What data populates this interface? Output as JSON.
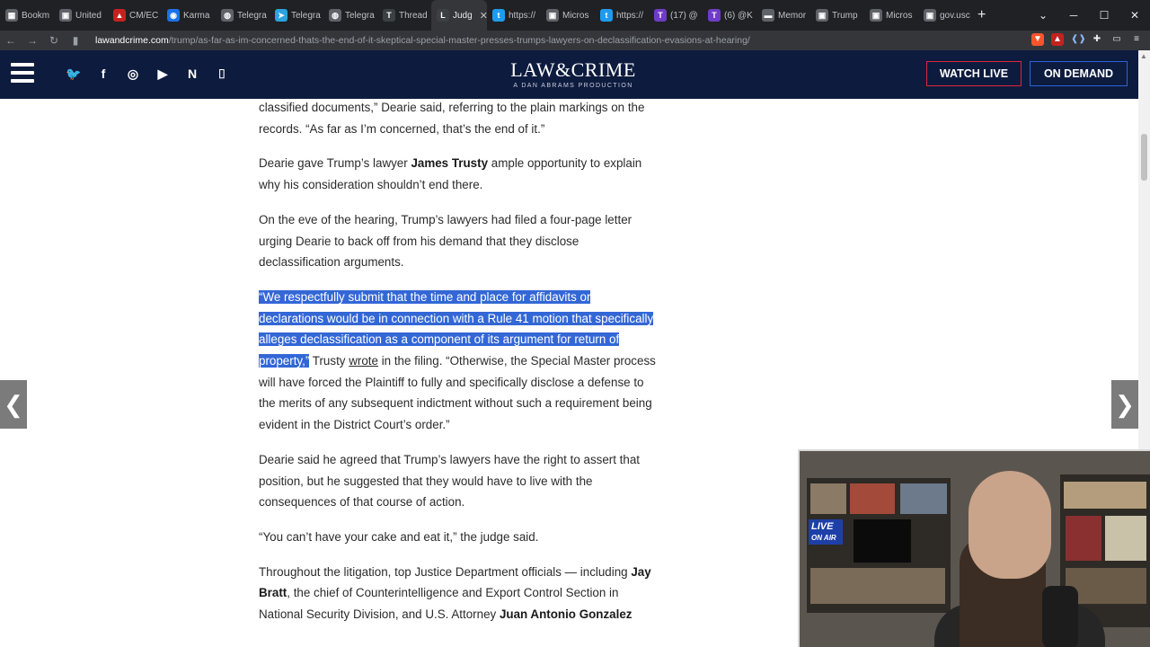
{
  "browser": {
    "tabs": [
      {
        "label": "Bookm",
        "color": "#5f6368",
        "glyph": "▦"
      },
      {
        "label": "United",
        "color": "#5f6368",
        "glyph": "▣"
      },
      {
        "label": "CM/EC",
        "color": "#c5221f",
        "glyph": "▲"
      },
      {
        "label": "Karma",
        "color": "#1a73e8",
        "glyph": "◉"
      },
      {
        "label": "Telegra",
        "color": "#5f6368",
        "glyph": "◍"
      },
      {
        "label": "Telegra",
        "color": "#2aa3e0",
        "glyph": "➤"
      },
      {
        "label": "Telegra",
        "color": "#5f6368",
        "glyph": "◍"
      },
      {
        "label": "Thread",
        "color": "#3c4043",
        "glyph": "T"
      },
      {
        "label": "Judg",
        "color": "#3c4043",
        "glyph": "L",
        "active": true
      },
      {
        "label": "https://",
        "color": "#1d9bf0",
        "glyph": "t"
      },
      {
        "label": "Micros",
        "color": "#5f6368",
        "glyph": "▣"
      },
      {
        "label": "https://",
        "color": "#1d9bf0",
        "glyph": "t"
      },
      {
        "label": "(17) @",
        "color": "#6f3cc7",
        "glyph": "T"
      },
      {
        "label": "(6) @K",
        "color": "#6f3cc7",
        "glyph": "T"
      },
      {
        "label": "Memor",
        "color": "#5f6368",
        "glyph": "▬"
      },
      {
        "label": "Trump",
        "color": "#5f6368",
        "glyph": "▣"
      },
      {
        "label": "Micros",
        "color": "#5f6368",
        "glyph": "▣"
      },
      {
        "label": "gov.usc",
        "color": "#5f6368",
        "glyph": "▣"
      }
    ],
    "new_tab": "+",
    "url_host": "lawandcrime.com",
    "url_path": "/trump/as-far-as-im-concerned-thats-the-end-of-it-skeptical-special-master-presses-trumps-lawyers-on-declassification-evasions-at-hearing/"
  },
  "site": {
    "logo_main": "LAW&CRIME",
    "logo_sub": "A DAN ABRAMS PRODUCTION",
    "watch_live": "WATCH LIVE",
    "on_demand": "ON DEMAND",
    "social": [
      {
        "name": "twitter-icon",
        "glyph": "🐦"
      },
      {
        "name": "facebook-icon",
        "glyph": "f"
      },
      {
        "name": "instagram-icon",
        "glyph": "◎"
      },
      {
        "name": "youtube-icon",
        "glyph": "▶"
      },
      {
        "name": "newsletter-icon",
        "glyph": "N"
      },
      {
        "name": "twitch-icon",
        "glyph": "⌷"
      }
    ]
  },
  "article": {
    "p1": "classified documents,” Dearie said, referring to the plain markings on the records. “As far as I’m concerned, that’s the end of it.”",
    "p2_a": "Dearie gave Trump’s lawyer ",
    "p2_b": "James Trusty",
    "p2_c": " ample opportunity to explain why his consideration shouldn’t end there.",
    "p3": "On the eve of the hearing, Trump’s lawyers had filed a four-page letter urging Dearie to back off from his demand that they disclose declassification arguments.",
    "p4_hl": "“We respectfully submit that the time and place for affidavits or declarations would be in connection with a Rule 41 motion that specifically alleges declassification as a component of its argument for return of property,”",
    "p4_a": " Trusty ",
    "p4_link": "wrote",
    "p4_b": " in the filing. “Otherwise, the Special Master process will have forced the Plaintiff to fully and specifically disclose a defense to the merits of any subsequent indictment without such a requirement being evident in the District Court’s order.”",
    "p5": "Dearie said he agreed that Trump’s lawyers have the right to assert that position, but he suggested that they would have to live with the consequences of that course of action.",
    "p6": "“You can’t have your cake and eat it,” the judge said.",
    "p7_a": "Throughout the litigation, top Justice Department officials — including ",
    "p7_b": "Jay Bratt",
    "p7_c": ", the chief of Counterintelligence and Export Control Section in National Security Division, and U.S. Attorney ",
    "p7_d": "Juan Antonio Gonzalez"
  },
  "webcam": {
    "sign_line1": "LIVE",
    "sign_line2": "ON AIR"
  }
}
